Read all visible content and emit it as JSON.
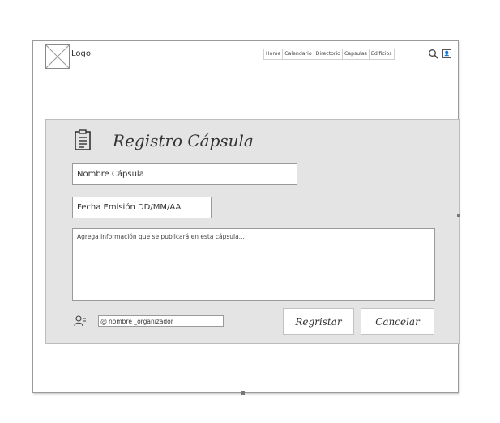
{
  "header": {
    "logo_label": "Logo",
    "nav": [
      "Home",
      "Calendario",
      "Directorio",
      "Capsulas",
      "Edificios"
    ],
    "search_icon": "search-icon",
    "user_icon": "user-icon",
    "user_glyph": "👤"
  },
  "form": {
    "icon": "clipboard-icon",
    "title": "Registro Cápsula",
    "nombre_placeholder": "Nombre Cápsula",
    "fecha_placeholder": "Fecha Emisión DD/MM/AA",
    "info_placeholder": "Agrega información que se publicará en esta cápsula...",
    "organizer_prefix": "@",
    "organizer_value": "nombre _organizador",
    "organizer_icon": "add-user-icon"
  },
  "buttons": {
    "register": "Regristar",
    "cancel": "Cancelar"
  }
}
